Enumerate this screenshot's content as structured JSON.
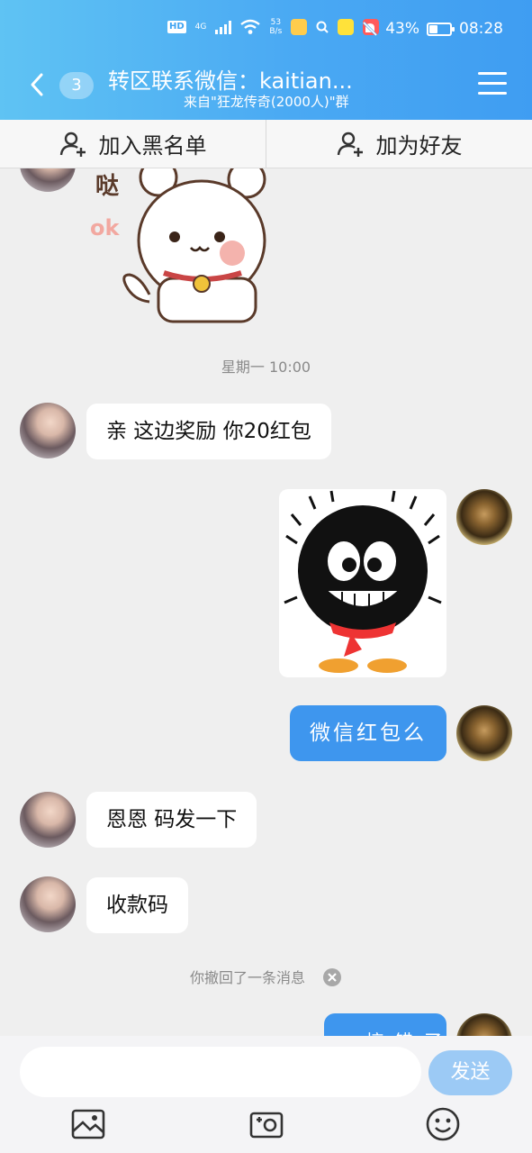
{
  "status_bar": {
    "left_badge": "HD",
    "network": "4G",
    "net_speed_value": "53",
    "net_speed_unit": "B/s",
    "battery": "43%",
    "battery_level": 0.43,
    "time": "08:28"
  },
  "header": {
    "unread_count": "3",
    "title": "转区联系微信：kaitian...",
    "subtitle": "来自\"狂龙传奇(2000人)\"群"
  },
  "actions": {
    "blacklist": "加入黑名单",
    "add_friend": "加为好友"
  },
  "messages": {
    "sticker_top_text": "哒",
    "sticker_ok": "ok",
    "timestamp": "星期一 10:00",
    "m1": "亲   这边奖励 你20红包",
    "m2": "微信红包么",
    "m3": "恩恩   码发一下",
    "m4": "收款码",
    "recalled": "你撤回了一条消息",
    "m5_partial": "o 搞 错 了"
  },
  "composer": {
    "send": "发送"
  },
  "colors": {
    "header_start": "#5fc3f3",
    "header_end": "#3f9df2",
    "outgoing_bubble": "#3e96ee",
    "send_button": "#9ccaf5"
  },
  "icons": [
    "back-icon",
    "menu-icon",
    "add-person-icon",
    "image-icon",
    "camera-icon",
    "emoji-icon",
    "close-circle-icon",
    "mute-icon",
    "wifi-icon"
  ]
}
